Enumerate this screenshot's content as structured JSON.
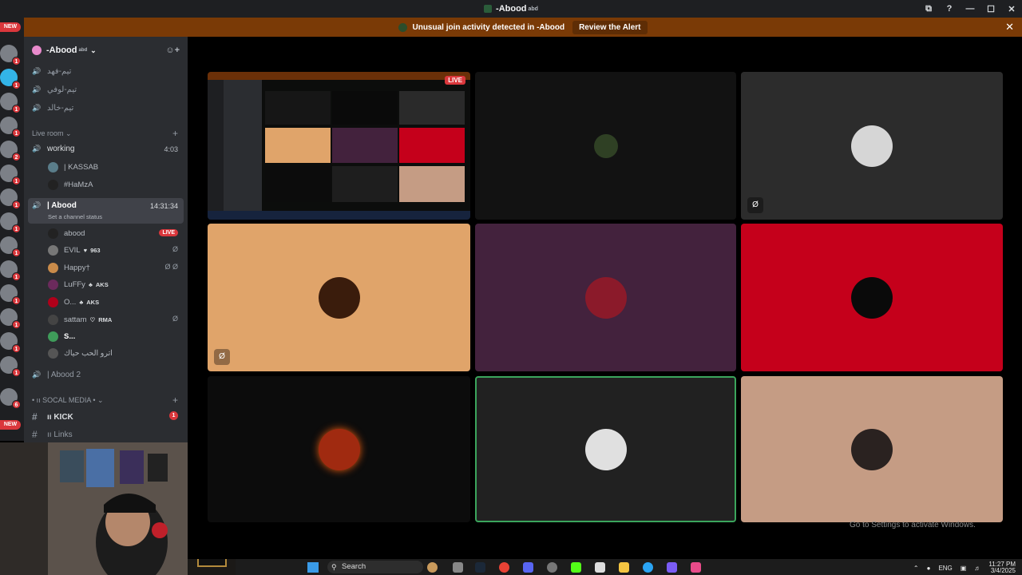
{
  "window": {
    "title": "-Abood",
    "title_sup": "abd",
    "controls": [
      "⧉",
      "?",
      "—",
      "☐",
      "✕"
    ]
  },
  "alert": {
    "text": "Unusual join activity detected in -Abood",
    "review_label": "Review the Alert",
    "close": "✕"
  },
  "server_rail": {
    "new_label": "NEW",
    "badge_counts": [
      "1",
      "1",
      "1",
      "1",
      "2",
      "1",
      "1",
      "1",
      "1",
      "1",
      "1",
      "1",
      "1",
      "1",
      "1",
      "1",
      "1",
      "1",
      "6"
    ]
  },
  "guild": {
    "name": "-Abood",
    "name_sup": "abd",
    "chevron": "⌄"
  },
  "channels": {
    "top": [
      "تيم-فهد",
      "تيم-لوفي",
      "تيم-خالد"
    ],
    "category_live": "Live room",
    "working": {
      "name": "working",
      "timer": "4:03",
      "members": [
        "| KASSAB",
        "#HaMzA"
      ]
    },
    "abood": {
      "name": "| Abood",
      "timer": "14:31:34",
      "status": "Set a channel status",
      "members": [
        {
          "name": "abood",
          "live": "LIVE"
        },
        {
          "name": "EVIL",
          "tag": "963",
          "tag_icon": "♥"
        },
        {
          "name": "Happy†"
        },
        {
          "name": "LuFFy",
          "tag": "AKS",
          "tag_icon": "♣"
        },
        {
          "name": "O...",
          "tag": "AKS",
          "tag_icon": "♣"
        },
        {
          "name": "sattam",
          "tag": "RMA",
          "tag_icon": "♡"
        },
        {
          "name": "S..."
        },
        {
          "name": "اترو الحب حياك"
        }
      ]
    },
    "abood2": "| Abood 2",
    "category_social": "• ıı SOCAL MEDIA •",
    "kick": {
      "name": "ıı KICK",
      "badge": "1"
    },
    "links": "ıı Links"
  },
  "stage": {
    "live_badge": "LIVE",
    "tile_colors": [
      "#0c0d0c",
      "#121212",
      "#2c2c2c",
      "#e0a46a",
      "#43223d",
      "#c5001b",
      "#0c0c0c",
      "#212121",
      "#c59c84"
    ]
  },
  "watermark": {
    "text": "Go to Settings to activate Windows."
  },
  "taskbar": {
    "search_label": "Search",
    "language": "ENG",
    "time": "11:27 PM",
    "date": "3/4/2025"
  }
}
